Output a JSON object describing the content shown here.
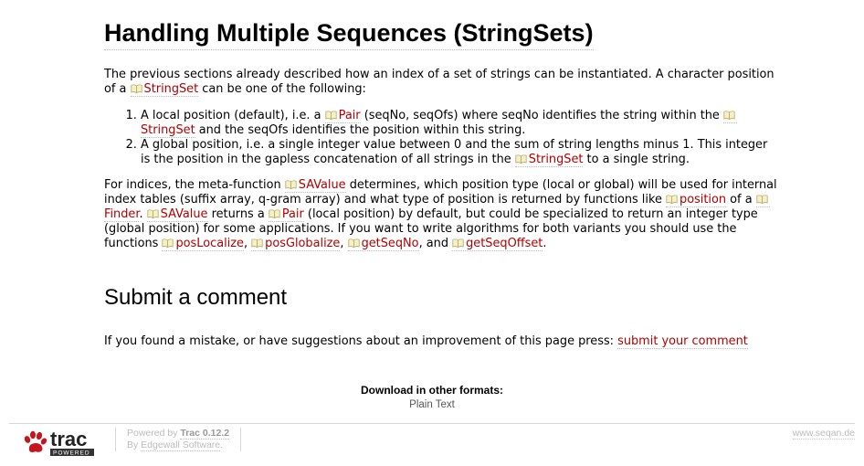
{
  "page": {
    "title": "Handling Multiple Sequences (StringSets)"
  },
  "intro": {
    "text1": "The previous sections already described how an index of a set of strings can be instantiated. A character position of a ",
    "link1": "StringSet",
    "text2": " can be one of the following:"
  },
  "list": {
    "item1": {
      "text1": "A local position (default), i.e. a ",
      "link1": "Pair",
      "text2": " (seqNo, seqOfs) where seqNo identifies the string within the ",
      "link2": "StringSet",
      "text3": " and the seqOfs identifies the position within this string."
    },
    "item2": {
      "text1": "A global position, i.e. a single integer value between 0 and the sum of string lengths minus 1. This integer is the position in the gapless concatenation of all strings in the ",
      "link1": "StringSet",
      "text2": " to a single string."
    }
  },
  "indices": {
    "text1": "For indices, the meta-function ",
    "link1": "SAValue",
    "text2": " determines, which position type (local or global) will be used for internal index tables (suffix array, q-gram array) and what type of position is returned by functions like ",
    "link2": "position",
    "text3": " of a ",
    "link3": "Finder",
    "text4": ". ",
    "link4": "SAValue",
    "text5": " returns a ",
    "link5": "Pair",
    "text6": " (local position) by default, but could be specialized to return an integer type (global position) for some applications. If you want to write algorithms for both variants you should use the functions ",
    "link6": "posLocalize",
    "text7": ", ",
    "link7": "posGlobalize",
    "text8": ", ",
    "link8": "getSeqNo",
    "text9": ", and ",
    "link9": "getSeqOffset",
    "text10": "."
  },
  "comment": {
    "heading": "Submit a comment",
    "text": "If you found a mistake, or have suggestions about an improvement of this page press: ",
    "link": "submit your comment"
  },
  "downloads": {
    "title": "Download in other formats:",
    "plain_text": "Plain Text"
  },
  "footer": {
    "logo_text": "trac",
    "logo_sub": "POWERED",
    "powered_prefix": "Powered by ",
    "powered_name": "Trac 0.12.2",
    "by_prefix": "By ",
    "by_name": "Edgewall Software",
    "by_suffix": ".",
    "site": "www.seqan.de"
  },
  "colors": {
    "link": "#b00000",
    "logo_red": "#c4161c"
  },
  "icons": {
    "wiki_link": "open-book-icon",
    "logo": "paw-icon"
  }
}
